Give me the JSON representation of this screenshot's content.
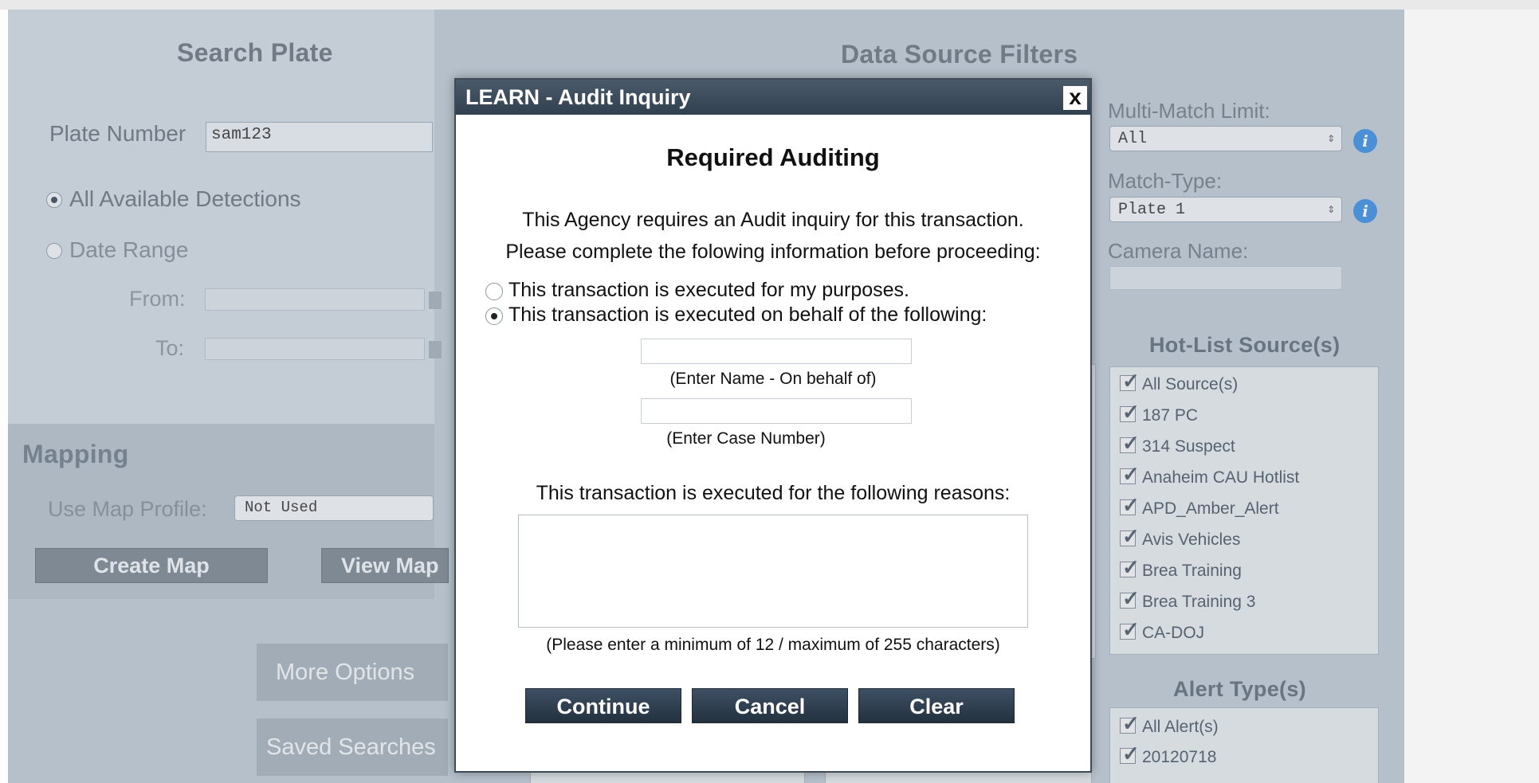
{
  "search": {
    "title": "Search Plate",
    "plate_label": "Plate Number",
    "plate_value": "sam123",
    "opt_all": "All Available Detections",
    "opt_range": "Date Range",
    "from_label": "From:",
    "to_label": "To:"
  },
  "mapping": {
    "title": "Mapping",
    "profile_label": "Use Map Profile:",
    "profile_value": "Not Used",
    "create_map": "Create Map",
    "view_map": "View Map"
  },
  "buttons": {
    "more_options": "More Options",
    "saved_searches": "Saved Searches"
  },
  "filters": {
    "title": "Data Source Filters",
    "multi_match_label": "Multi-Match Limit:",
    "multi_match_value": "All",
    "match_type_label": "Match-Type:",
    "match_type_value": "Plate 1",
    "camera_name_label": "Camera Name:",
    "hotlist_title": "Hot-List Source(s)",
    "hotlist_items": [
      "All Source(s)",
      "187 PC",
      "314 Suspect",
      "Anaheim CAU Hotlist",
      "APD_Amber_Alert",
      "Avis Vehicles",
      "Brea Training",
      "Brea Training 3",
      "CA-DOJ"
    ],
    "alert_title": "Alert Type(s)",
    "alert_items": [
      "All Alert(s)",
      "20120718"
    ]
  },
  "modal": {
    "title": "LEARN - Audit Inquiry",
    "close": "x",
    "heading": "Required Auditing",
    "intro_line1": "This Agency requires an Audit inquiry for this transaction.",
    "intro_line2": "Please complete the folowing information before proceeding:",
    "option_mine": "This transaction is executed for my purposes.",
    "option_behalf": "This transaction is executed on behalf of the following:",
    "name_hint": "(Enter Name - On behalf of)",
    "case_hint": "(Enter Case Number)",
    "reasons_label": "This transaction is executed for the following reasons:",
    "reasons_hint": "(Please enter a minimum of 12 / maximum of 255 characters)",
    "continue": "Continue",
    "cancel": "Cancel",
    "clear": "Clear"
  }
}
